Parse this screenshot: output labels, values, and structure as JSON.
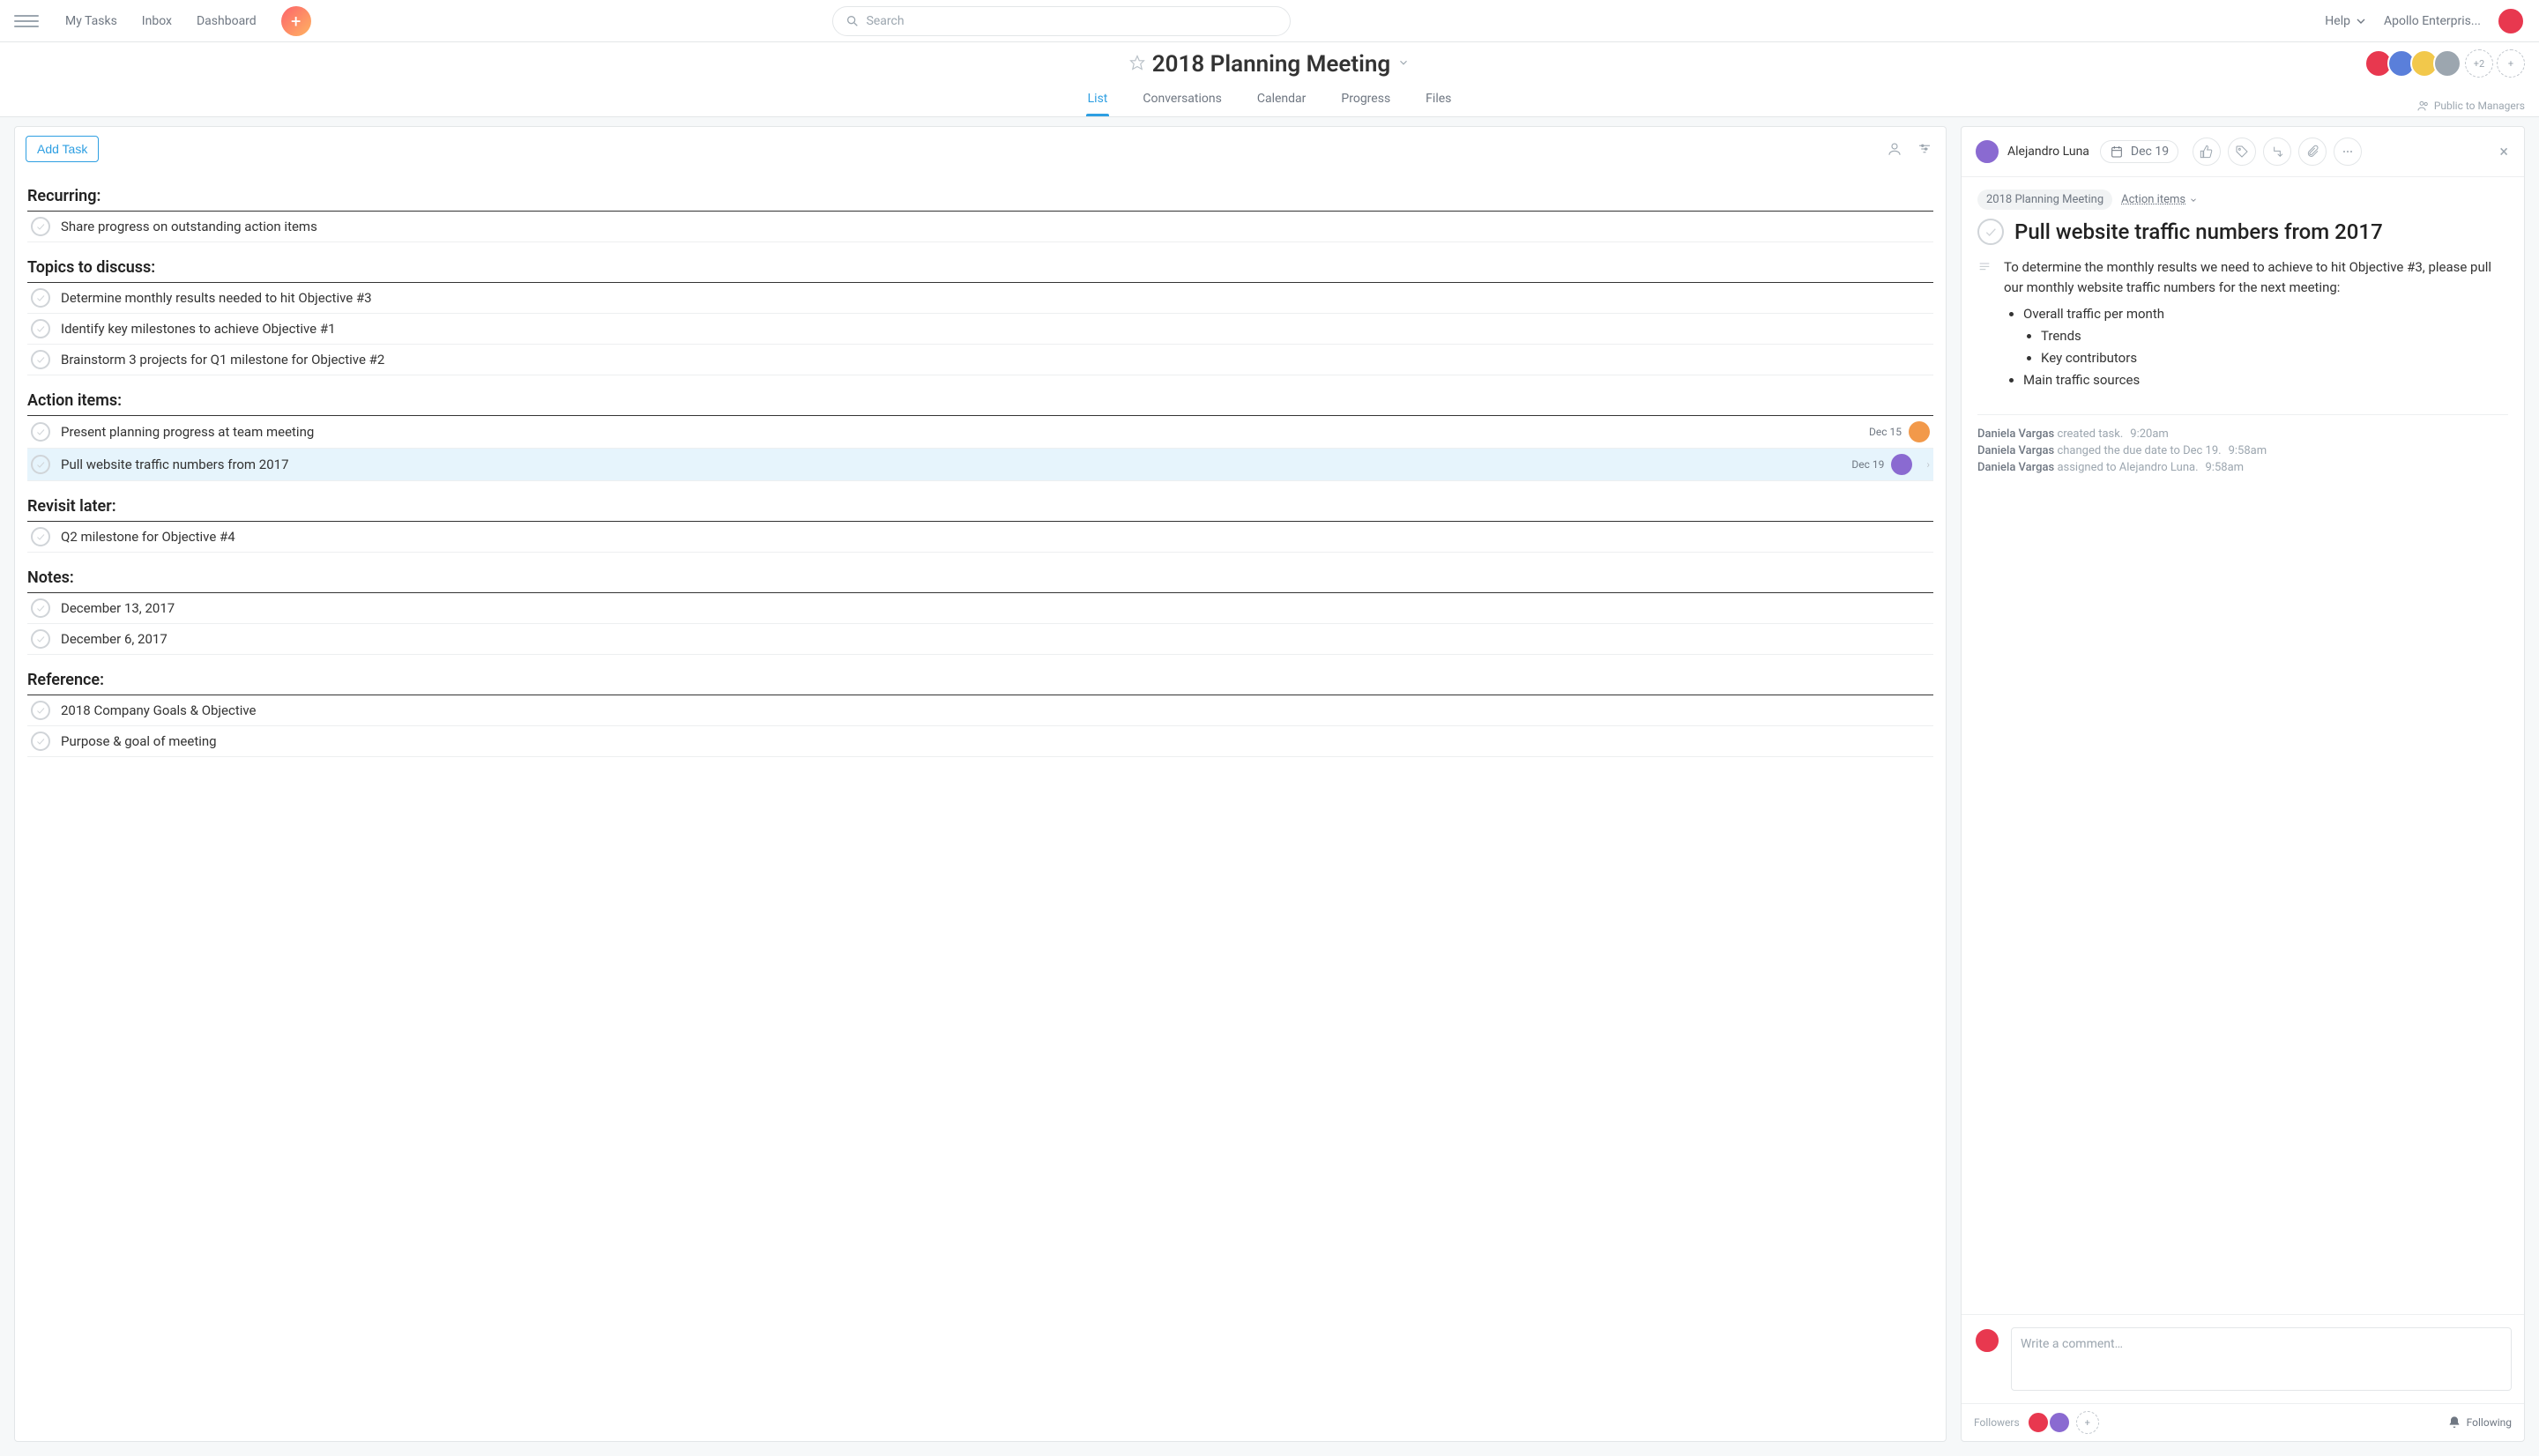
{
  "topnav": {
    "my_tasks": "My Tasks",
    "inbox": "Inbox",
    "dashboard": "Dashboard",
    "search_placeholder": "Search",
    "help": "Help",
    "workspace": "Apollo Enterpris..."
  },
  "project": {
    "title": "2018 Planning Meeting",
    "public_label": "Public to Managers",
    "more_count": "+2",
    "tabs": {
      "list": "List",
      "conversations": "Conversations",
      "calendar": "Calendar",
      "progress": "Progress",
      "files": "Files"
    }
  },
  "list": {
    "add_task": "Add Task",
    "sections": [
      {
        "name": "Recurring:",
        "tasks": [
          {
            "title": "Share progress on outstanding action items"
          }
        ]
      },
      {
        "name": "Topics to discuss:",
        "tasks": [
          {
            "title": "Determine monthly results needed to hit Objective #3"
          },
          {
            "title": "Identify key milestones to achieve Objective #1"
          },
          {
            "title": "Brainstorm 3 projects for Q1 milestone for Objective #2"
          }
        ]
      },
      {
        "name": "Action items:",
        "tasks": [
          {
            "title": "Present planning progress at team meeting",
            "due": "Dec 15",
            "avatar": "av-orange"
          },
          {
            "title": "Pull website traffic numbers from 2017",
            "due": "Dec 19",
            "avatar": "av-purple",
            "selected": true
          }
        ]
      },
      {
        "name": "Revisit later:",
        "tasks": [
          {
            "title": "Q2 milestone for Objective #4"
          }
        ]
      },
      {
        "name": "Notes:",
        "tasks": [
          {
            "title": "December 13, 2017"
          },
          {
            "title": "December 6, 2017"
          }
        ]
      },
      {
        "name": "Reference:",
        "tasks": [
          {
            "title": "2018 Company Goals & Objective"
          },
          {
            "title": "Purpose & goal of meeting"
          }
        ]
      }
    ]
  },
  "detail": {
    "assignee_name": "Alejandro Luna",
    "due": "Dec 19",
    "crumb_project": "2018 Planning Meeting",
    "crumb_section": "Action items",
    "title": "Pull website traffic numbers from 2017",
    "description_intro": "To determine the monthly results we need to achieve to hit Objective #3, please pull our monthly website traffic numbers for the next meeting:",
    "bullets": {
      "b1": "Overall traffic per month",
      "b1a": "Trends",
      "b1b": "Key contributors",
      "b2": "Main traffic sources"
    },
    "activity": [
      {
        "who": "Daniela Vargas",
        "what": "created task.",
        "time": "9:20am"
      },
      {
        "who": "Daniela Vargas",
        "what": "changed the due date to Dec 19.",
        "time": "9:58am"
      },
      {
        "who": "Daniela Vargas",
        "what": "assigned to Alejandro Luna.",
        "time": "9:58am"
      }
    ],
    "comment_placeholder": "Write a comment…",
    "followers_label": "Followers",
    "following_label": "Following"
  }
}
